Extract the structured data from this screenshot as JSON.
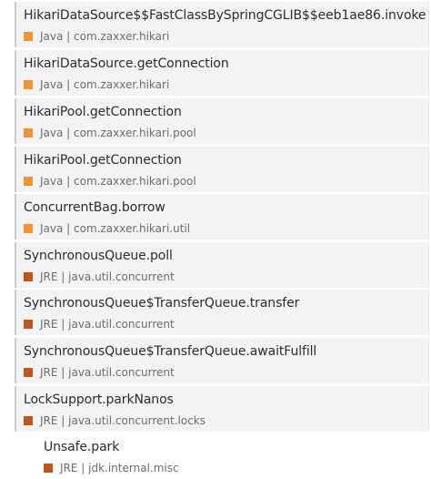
{
  "colors": {
    "java": "#f29136",
    "jre": "#c0551e"
  },
  "frames": [
    {
      "method": "HikariDataSource$$FastClassBySpringCGLIB$$eeb1ae86.invoke",
      "meta": "Java | com.zaxxer.hikari",
      "kind": "java"
    },
    {
      "method": "HikariDataSource.getConnection",
      "meta": "Java | com.zaxxer.hikari",
      "kind": "java"
    },
    {
      "method": "HikariPool.getConnection",
      "meta": "Java | com.zaxxer.hikari.pool",
      "kind": "java"
    },
    {
      "method": "HikariPool.getConnection",
      "meta": "Java | com.zaxxer.hikari.pool",
      "kind": "java"
    },
    {
      "method": "ConcurrentBag.borrow",
      "meta": "Java | com.zaxxer.hikari.util",
      "kind": "java"
    },
    {
      "method": "SynchronousQueue.poll",
      "meta": "JRE | java.util.concurrent",
      "kind": "jre"
    },
    {
      "method": "SynchronousQueue$TransferQueue.transfer",
      "meta": "JRE | java.util.concurrent",
      "kind": "jre"
    },
    {
      "method": "SynchronousQueue$TransferQueue.awaitFulfill",
      "meta": "JRE | java.util.concurrent",
      "kind": "jre"
    },
    {
      "method": "LockSupport.parkNanos",
      "meta": "JRE | java.util.concurrent.locks",
      "kind": "jre"
    },
    {
      "method": "Unsafe.park",
      "meta": "JRE | jdk.internal.misc",
      "kind": "jre"
    }
  ]
}
